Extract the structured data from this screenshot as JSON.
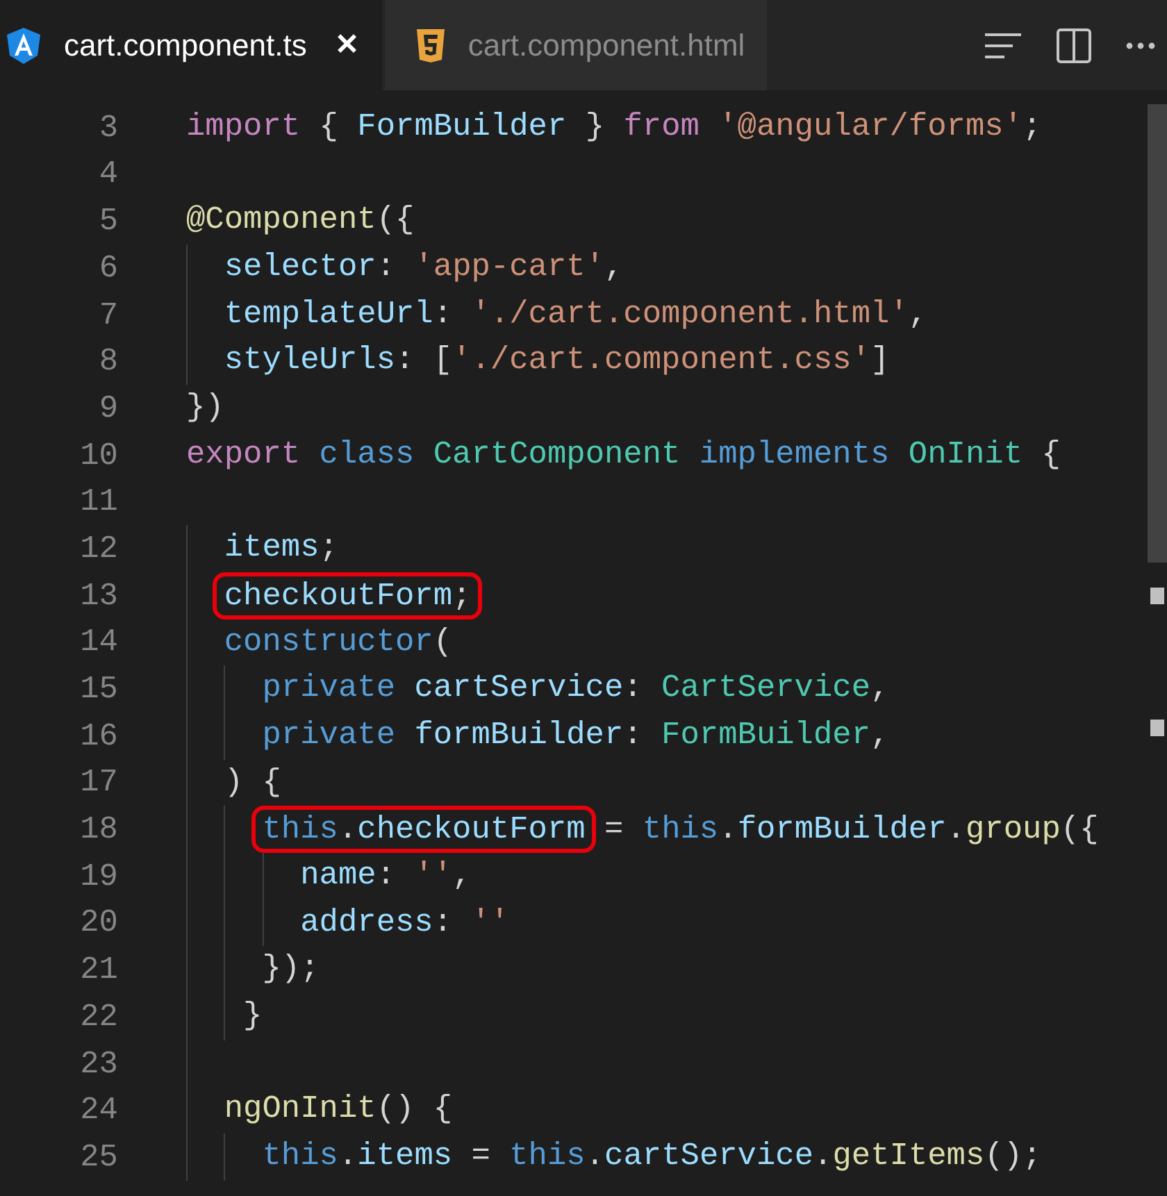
{
  "tabs": [
    {
      "label": "cart.component.ts",
      "selected": true,
      "close": "✕"
    },
    {
      "label": "cart.component.html",
      "selected": false
    }
  ],
  "lines": [
    {
      "number": "3",
      "tokens": [
        {
          "text": "import",
          "kind": "keyword"
        },
        {
          "text": " {",
          "kind": "plain"
        },
        {
          "text": " FormBuilder",
          "kind": "variable"
        },
        {
          "text": " }",
          "kind": "plain"
        },
        {
          "text": " from",
          "kind": "keyword"
        },
        {
          "text": " '@angular/forms'",
          "kind": "string"
        },
        {
          "text": ";",
          "kind": "plain"
        }
      ]
    },
    {
      "number": "4"
    },
    {
      "number": "5",
      "tokens": [
        {
          "text": "@Component",
          "kind": "function"
        },
        {
          "text": "({",
          "kind": "plain"
        }
      ]
    },
    {
      "number": "6",
      "tokens": [
        {
          "text": "  selector",
          "kind": "variable"
        },
        {
          "text": ":",
          "kind": "plain"
        },
        {
          "text": " 'app-cart'",
          "kind": "string"
        },
        {
          "text": ",",
          "kind": "plain"
        }
      ]
    },
    {
      "number": "7",
      "tokens": [
        {
          "text": "  templateUrl",
          "kind": "variable"
        },
        {
          "text": ":",
          "kind": "plain"
        },
        {
          "text": " './cart.component.html'",
          "kind": "string"
        },
        {
          "text": ",",
          "kind": "plain"
        }
      ]
    },
    {
      "number": "8",
      "tokens": [
        {
          "text": "  styleUrls",
          "kind": "variable"
        },
        {
          "text": ": [",
          "kind": "plain"
        },
        {
          "text": "'./cart.component.css'",
          "kind": "string"
        },
        {
          "text": "]",
          "kind": "plain"
        }
      ]
    },
    {
      "number": "9",
      "tokens": [
        {
          "text": "})",
          "kind": "plain"
        }
      ]
    },
    {
      "number": "10",
      "tokens": [
        {
          "text": "export",
          "kind": "keyword"
        },
        {
          "text": " class",
          "kind": "storage"
        },
        {
          "text": " CartComponent",
          "kind": "type"
        },
        {
          "text": " implements",
          "kind": "storage"
        },
        {
          "text": " OnInit",
          "kind": "type"
        },
        {
          "text": " {",
          "kind": "plain"
        }
      ]
    },
    {
      "number": "11"
    },
    {
      "number": "12",
      "tokens": [
        {
          "text": "  items",
          "kind": "variable"
        },
        {
          "text": ";",
          "kind": "plain"
        }
      ]
    },
    {
      "number": "13",
      "tokens": [
        {
          "text": "  checkoutForm",
          "kind": "variable",
          "boxed": true
        },
        {
          "text": ";",
          "kind": "plain",
          "boxed": true
        }
      ]
    },
    {
      "number": "14",
      "tokens": [
        {
          "text": "  constructor",
          "kind": "storage"
        },
        {
          "text": "(",
          "kind": "plain"
        }
      ]
    },
    {
      "number": "15",
      "tokens": [
        {
          "text": "    private",
          "kind": "storage"
        },
        {
          "text": " cartService",
          "kind": "variable"
        },
        {
          "text": ":",
          "kind": "plain"
        },
        {
          "text": " CartService",
          "kind": "type"
        },
        {
          "text": ",",
          "kind": "plain"
        }
      ]
    },
    {
      "number": "16",
      "tokens": [
        {
          "text": "    private",
          "kind": "storage"
        },
        {
          "text": " formBuilder",
          "kind": "variable"
        },
        {
          "text": ":",
          "kind": "plain"
        },
        {
          "text": " FormBuilder",
          "kind": "type"
        },
        {
          "text": ",",
          "kind": "plain"
        }
      ]
    },
    {
      "number": "17",
      "tokens": [
        {
          "text": "  ) {",
          "kind": "plain"
        }
      ]
    },
    {
      "number": "18",
      "tokens": [
        {
          "text": "    this",
          "kind": "storage",
          "boxed": true
        },
        {
          "text": ".",
          "kind": "plain",
          "boxed": true
        },
        {
          "text": "checkoutForm",
          "kind": "variable",
          "boxed": true
        },
        {
          "text": " =",
          "kind": "plain"
        },
        {
          "text": " this",
          "kind": "storage"
        },
        {
          "text": ".",
          "kind": "plain"
        },
        {
          "text": "formBuilder",
          "kind": "variable"
        },
        {
          "text": ".",
          "kind": "plain"
        },
        {
          "text": "group",
          "kind": "function"
        },
        {
          "text": "({",
          "kind": "plain"
        }
      ]
    },
    {
      "number": "19",
      "tokens": [
        {
          "text": "      name",
          "kind": "variable"
        },
        {
          "text": ":",
          "kind": "plain"
        },
        {
          "text": " ''",
          "kind": "string"
        },
        {
          "text": ",",
          "kind": "plain"
        }
      ]
    },
    {
      "number": "20",
      "tokens": [
        {
          "text": "      address",
          "kind": "variable"
        },
        {
          "text": ":",
          "kind": "plain"
        },
        {
          "text": " ''",
          "kind": "string"
        }
      ]
    },
    {
      "number": "21",
      "tokens": [
        {
          "text": "    });",
          "kind": "plain"
        }
      ]
    },
    {
      "number": "22",
      "tokens": [
        {
          "text": "   }",
          "kind": "plain"
        }
      ]
    },
    {
      "number": "23"
    },
    {
      "number": "24",
      "tokens": [
        {
          "text": "  ngOnInit",
          "kind": "function"
        },
        {
          "text": "() {",
          "kind": "plain"
        }
      ]
    },
    {
      "number": "25",
      "tokens": [
        {
          "text": "    this",
          "kind": "storage"
        },
        {
          "text": ".",
          "kind": "plain"
        },
        {
          "text": "items",
          "kind": "variable"
        },
        {
          "text": " =",
          "kind": "plain"
        },
        {
          "text": " this",
          "kind": "storage"
        },
        {
          "text": ".",
          "kind": "plain"
        },
        {
          "text": "cartService",
          "kind": "variable"
        },
        {
          "text": ".",
          "kind": "plain"
        },
        {
          "text": "getItems",
          "kind": "function"
        },
        {
          "text": "();",
          "kind": "plain"
        }
      ]
    }
  ]
}
